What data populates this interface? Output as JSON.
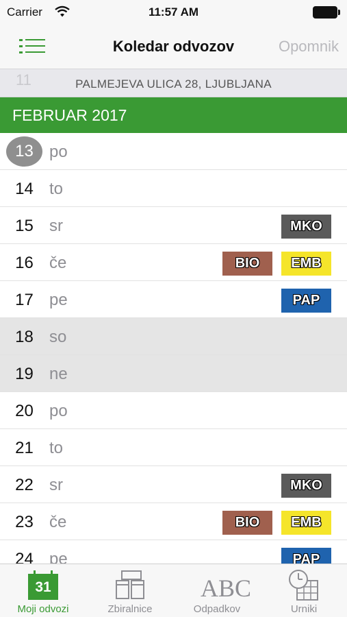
{
  "status_bar": {
    "carrier": "Carrier",
    "time": "11:57 AM"
  },
  "nav_bar": {
    "title": "Koledar odvozov",
    "right_button": "Opomnik"
  },
  "address": {
    "ghost_day": "11",
    "text": "PALMEJEVA ULICA 28, LJUBLJANA"
  },
  "month": {
    "label": "FEBRUAR 2017"
  },
  "days": [
    {
      "num": "13",
      "dow": "po",
      "today": true
    },
    {
      "num": "14",
      "dow": "to"
    },
    {
      "num": "15",
      "dow": "sr",
      "badges": [
        "MKO"
      ]
    },
    {
      "num": "16",
      "dow": "če",
      "badges": [
        "BIO",
        "EMB"
      ]
    },
    {
      "num": "17",
      "dow": "pe",
      "badges": [
        "PAP"
      ]
    },
    {
      "num": "18",
      "dow": "so",
      "weekend": true
    },
    {
      "num": "19",
      "dow": "ne",
      "weekend": true
    },
    {
      "num": "20",
      "dow": "po"
    },
    {
      "num": "21",
      "dow": "to"
    },
    {
      "num": "22",
      "dow": "sr",
      "badges": [
        "MKO"
      ]
    },
    {
      "num": "23",
      "dow": "če",
      "badges": [
        "BIO",
        "EMB"
      ]
    },
    {
      "num": "24",
      "dow": "pe",
      "badges": [
        "PAP"
      ]
    }
  ],
  "badge_colors": {
    "MKO": "#5a5a5a",
    "BIO": "#a0604e",
    "EMB": "#f5e52a",
    "PAP": "#1f63ae"
  },
  "tabs": [
    {
      "label": "Moji odvozi",
      "icon": "calendar-icon",
      "icon_text": "31",
      "active": true
    },
    {
      "label": "Zbiralnice",
      "icon": "containers-icon"
    },
    {
      "label": "Odpadkov",
      "icon": "abc-icon",
      "icon_text": "ABC"
    },
    {
      "label": "Urniki",
      "icon": "clock-schedule-icon"
    }
  ],
  "colors": {
    "accent": "#3a9a34",
    "weekend_row": "#e5e5e5",
    "bar_bg": "#f7f7f7"
  }
}
